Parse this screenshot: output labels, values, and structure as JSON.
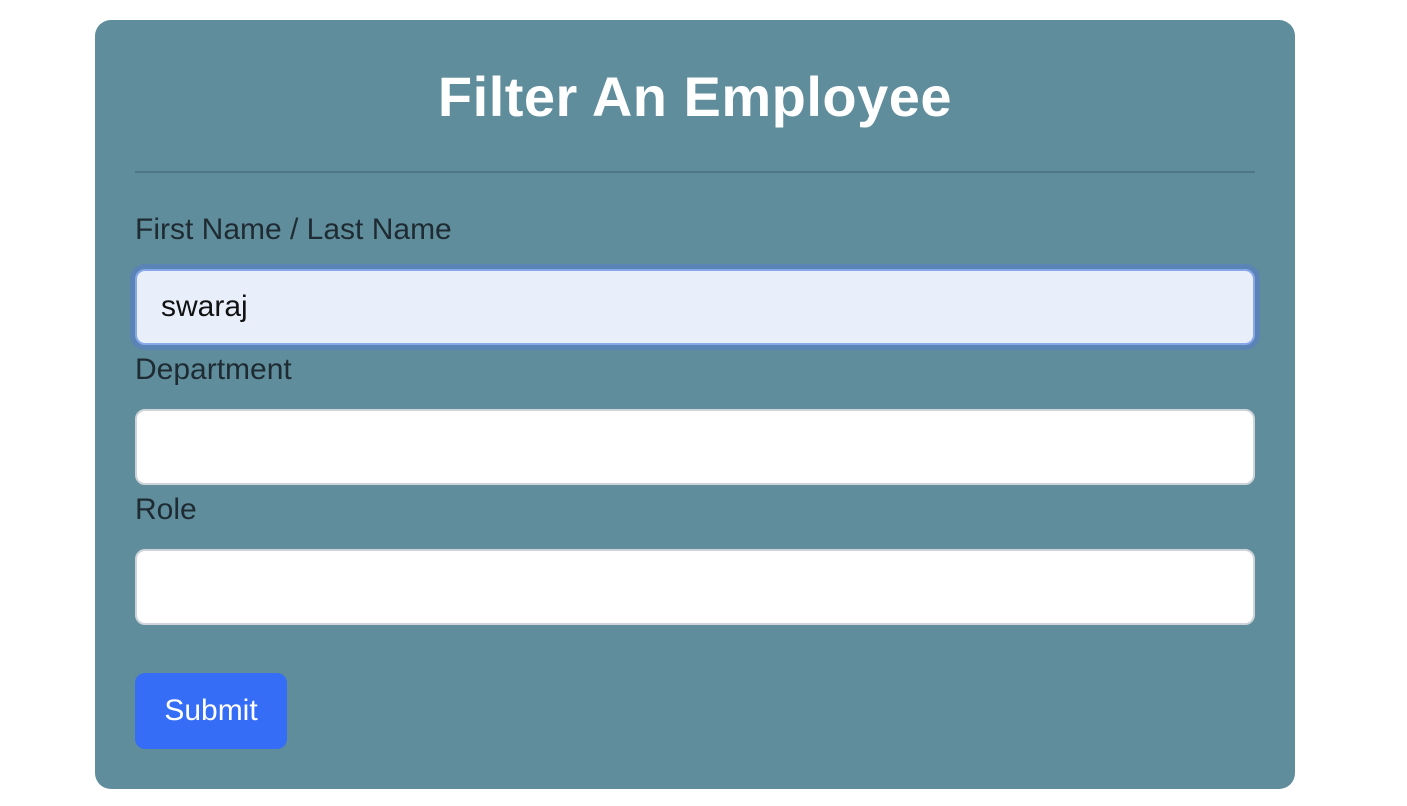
{
  "form": {
    "title": "Filter An Employee",
    "fields": [
      {
        "label": "First Name / Last Name",
        "value": "swaraj",
        "placeholder": "",
        "focused": true
      },
      {
        "label": "Department",
        "value": "",
        "placeholder": ""
      },
      {
        "label": "Role",
        "value": "",
        "placeholder": ""
      }
    ],
    "submit_label": "Submit"
  },
  "colors": {
    "card_background": "#5f8d9b",
    "submit_button": "#356df7",
    "focused_input_background": "#e8effb"
  }
}
